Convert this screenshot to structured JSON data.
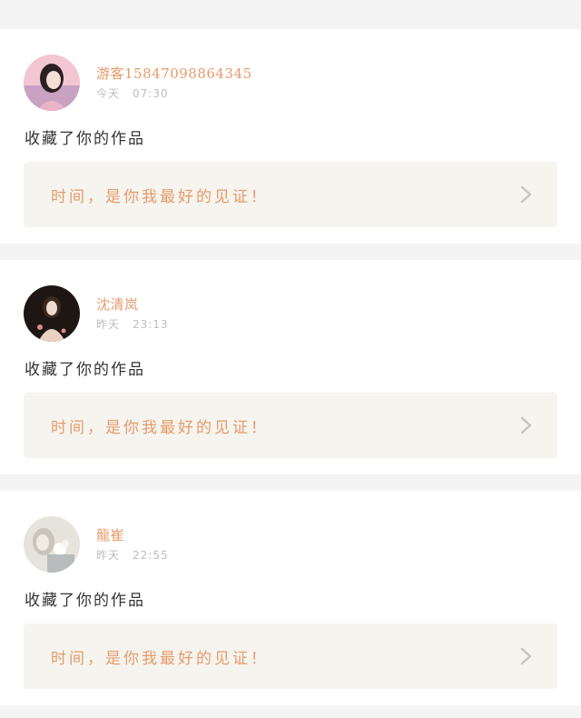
{
  "feed": [
    {
      "user_name": "游客15847098864345",
      "date_label": "今天",
      "time": "07:30",
      "action_text": "收藏了你的作品",
      "work_title": "时间，是你我最好的见证！",
      "avatar_colors": [
        "#f3c6d3",
        "#c9a2c1",
        "#2b1f24"
      ]
    },
    {
      "user_name": "沈清岚",
      "date_label": "昨天",
      "time": "23:13",
      "action_text": "收藏了你的作品",
      "work_title": "时间，是你我最好的见证！",
      "avatar_colors": [
        "#1e1612",
        "#e9d2c2",
        "#3a2a1e"
      ]
    },
    {
      "user_name": "龍崔",
      "date_label": "昨天",
      "time": "22:55",
      "action_text": "收藏了你的作品",
      "work_title": "时间，是你我最好的见证！",
      "avatar_colors": [
        "#e6e3dc",
        "#c9c3b8",
        "#9aa2a8"
      ]
    }
  ],
  "colors": {
    "accent": "#e79a6b",
    "page_background": "#f4f4f4",
    "card_background": "#ffffff",
    "work_background": "#f5f4ee",
    "muted_text": "#bdbdbd"
  },
  "icons": {
    "chevron": "chevron-right-icon"
  }
}
